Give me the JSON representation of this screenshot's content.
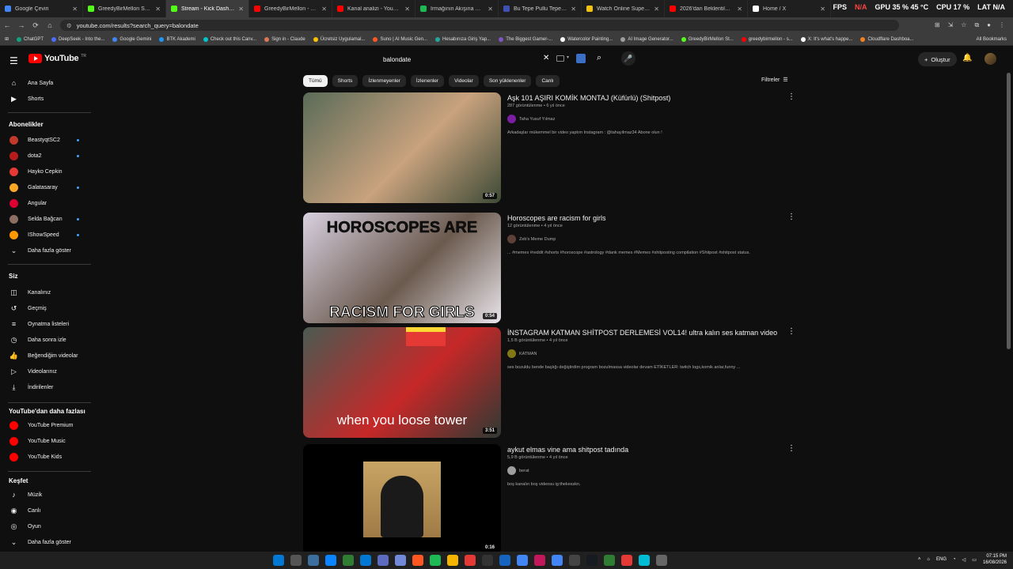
{
  "tabs": [
    {
      "label": "Google Çeviri",
      "color": "#4285f4"
    },
    {
      "label": "GreedyBirMellon Stream",
      "color": "#53fc18"
    },
    {
      "label": "Stream - Kick Dashboard",
      "color": "#53fc18"
    },
    {
      "label": "GreedyBirMellon - YouTube",
      "color": "#ff0000"
    },
    {
      "label": "Kanal analizi - YouTube St",
      "color": "#ff0000"
    },
    {
      "label": "Irmağının Akışına Ölürüm",
      "color": "#1db954"
    },
    {
      "label": "Bu Tepe Pullu Tepe Notalı",
      "color": "#3f51b5"
    },
    {
      "label": "Watch Online Supernatural",
      "color": "#f4c20d"
    },
    {
      "label": "2026'dan Beklentiler - Cli",
      "color": "#ff0000"
    },
    {
      "label": "Home / X",
      "color": "#ffffff"
    }
  ],
  "hud": {
    "fps": "FPS",
    "fps_val": "N/A",
    "gpu": "GPU 35 % 45 °C",
    "cpu": "CPU 17 %",
    "lat": "LAT N/A"
  },
  "address": {
    "url": "youtube.com/results?search_query=balondate"
  },
  "bookmarks": [
    "ChatGPT",
    "DeepSeek - Into the...",
    "Google Gemini",
    "BTK Akademi",
    "Check out this Canv...",
    "Sign in - Claude",
    "Ücretsiz Uygulamal...",
    "Suno | AI Music Gen...",
    "Hesabınıza Giriş Yap...",
    "The Biggest Gamer-...",
    "Watercolor Painting...",
    "AI Image Generator...",
    "GreedyBirMellon St...",
    "greedybirmellon - s...",
    "X: It's what's happe...",
    "Cloudflare Dashboa..."
  ],
  "bookmarks_all": "All Bookmarks",
  "youtube": {
    "logo": "YouTube",
    "logo_tr": "TR",
    "search_value": "balondate",
    "create": "Oluştur"
  },
  "sidebar": {
    "main": [
      {
        "label": "Ana Sayfa",
        "icon": "home-icon"
      },
      {
        "label": "Shorts",
        "icon": "shorts-icon"
      }
    ],
    "subs_title": "Abonelikler",
    "subs": [
      {
        "label": "BeastyqtSC2",
        "color": "#c0392b",
        "live": true
      },
      {
        "label": "dota2",
        "color": "#b71c1c",
        "live": true
      },
      {
        "label": "Hayko Cepkin",
        "color": "#e53935",
        "live": false
      },
      {
        "label": "Galatasaray",
        "color": "#f9a825",
        "live": true
      },
      {
        "label": "Angular",
        "color": "#dd0031",
        "live": false
      },
      {
        "label": "Selda Bağcan",
        "color": "#8d6e63",
        "live": true
      },
      {
        "label": "IShowSpeed",
        "color": "#ff9800",
        "live": true
      }
    ],
    "show_more": "Daha fazla göster",
    "you_title": "Siz",
    "you": [
      {
        "label": "Kanalınız",
        "icon": "channel-icon"
      },
      {
        "label": "Geçmiş",
        "icon": "history-icon"
      },
      {
        "label": "Oynatma listeleri",
        "icon": "playlist-icon"
      },
      {
        "label": "Daha sonra izle",
        "icon": "clock-icon"
      },
      {
        "label": "Beğendiğim videolar",
        "icon": "like-icon"
      },
      {
        "label": "Videolarınız",
        "icon": "video-icon"
      },
      {
        "label": "İndirilenler",
        "icon": "download-icon"
      }
    ],
    "more_title": "YouTube'dan daha fazlası",
    "more": [
      "YouTube Premium",
      "YouTube Music",
      "YouTube Kids"
    ],
    "explore_title": "Keşfet",
    "explore": [
      {
        "label": "Müzik",
        "icon": "music-icon"
      },
      {
        "label": "Canlı",
        "icon": "live-icon"
      },
      {
        "label": "Oyun",
        "icon": "game-icon"
      }
    ],
    "show_more2": "Daha fazla göster"
  },
  "chips": [
    "Tümü",
    "Shorts",
    "İzlenmeyenler",
    "İzlenenler",
    "Videolar",
    "Son yüklenenler",
    "Canlı"
  ],
  "filters": "Filtreler",
  "results": [
    {
      "title": "Aşk 101 AŞIRI KOMİK MONTAJ (Küfürlü) (Shitpost)",
      "meta": "287 görüntülenme • 6 yıl önce",
      "channel": "Taha Yusuf Yılmaz",
      "desc": "Arkadaşlar mükemmel bir video yaptım Instagram : @tahayilmaz34 Abone olun !",
      "duration": "0:57",
      "thumb_colors": [
        "#5a6b58",
        "#c9a27e",
        "#3d4a36"
      ],
      "ch_color": "#7b1fa2"
    },
    {
      "title": "Horoscopes are racism for girls",
      "meta": "12 görüntülenme • 4 yıl önce",
      "channel": "Zeb's Meme Dump",
      "desc": "... #memes #reddit #shorts #horoscope #astrology #dank memes #Memes #shitposting compilation #Shitpost #shitpost status.",
      "duration": "0:54",
      "thumb_top": "HOROSCOPES ARE",
      "thumb_bottom": "RACISM FOR GIRLS",
      "thumb_colors": [
        "#d8d0e0",
        "#6b5a4e",
        "#e8e4ea"
      ],
      "ch_color": "#5d4037"
    },
    {
      "title": "İNSTAGRAM KATMAN SHİTPOST DERLEMESİ VOL14! ultra kalın ses katman video",
      "meta": "1,5 B görüntülenme • 4 yıl önce",
      "channel": "KATMAN",
      "desc": "ses bozuldu bende başlığı değiştirdim program bozulmassa videolar devam ETİKETLER: twitch logs,komik anlar,funny ...",
      "duration": "3:51",
      "thumb_caption": "when you loose tower",
      "thumb_colors": [
        "#4a5a52",
        "#c62828",
        "#2f3a34"
      ],
      "ch_color": "#827717"
    },
    {
      "title": "aykut elmas vine ama shitpost tadında",
      "meta": "5,9 B görüntülenme • 4 yıl önce",
      "channel": "berat",
      "desc": "boş kanalın boş videosu ig:thekesskn.",
      "duration": "0:16",
      "thumb_colors": [
        "#000000",
        "#c8a565",
        "#1a1a1a"
      ],
      "ch_color": "#9e9e9e"
    }
  ],
  "taskbar": {
    "lang": "ENG",
    "time": "07:15 PM",
    "date": "16/08/2026"
  }
}
